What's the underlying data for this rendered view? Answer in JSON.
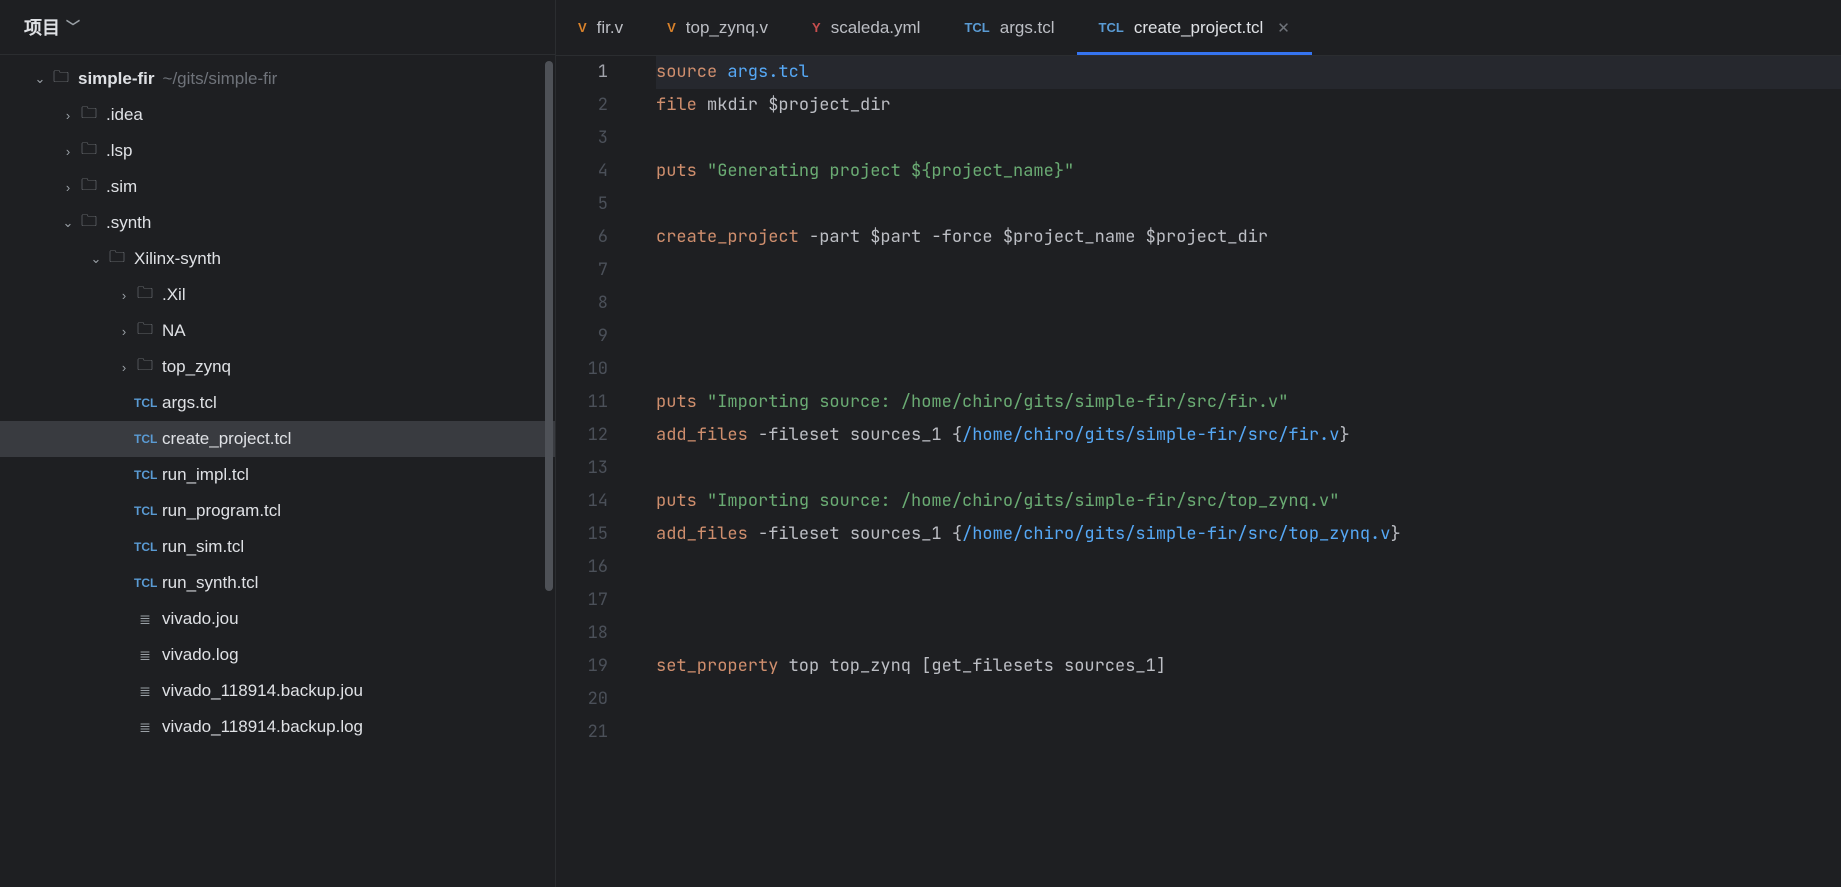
{
  "sidebar": {
    "title": "项目",
    "root": {
      "name": "simple-fir",
      "path": "~/gits/simple-fir"
    },
    "items": [
      {
        "type": "folder",
        "name": ".idea",
        "depth": 1,
        "expanded": false
      },
      {
        "type": "folder",
        "name": ".lsp",
        "depth": 1,
        "expanded": false
      },
      {
        "type": "folder",
        "name": ".sim",
        "depth": 1,
        "expanded": false
      },
      {
        "type": "folder",
        "name": ".synth",
        "depth": 1,
        "expanded": true
      },
      {
        "type": "folder",
        "name": "Xilinx-synth",
        "depth": 2,
        "expanded": true
      },
      {
        "type": "folder",
        "name": ".Xil",
        "depth": 3,
        "expanded": false
      },
      {
        "type": "folder",
        "name": "NA",
        "depth": 3,
        "expanded": false
      },
      {
        "type": "folder",
        "name": "top_zynq",
        "depth": 3,
        "expanded": false
      },
      {
        "type": "file",
        "icon": "tcl",
        "name": "args.tcl",
        "depth": 3
      },
      {
        "type": "file",
        "icon": "tcl",
        "name": "create_project.tcl",
        "depth": 3,
        "selected": true
      },
      {
        "type": "file",
        "icon": "tcl",
        "name": "run_impl.tcl",
        "depth": 3
      },
      {
        "type": "file",
        "icon": "tcl",
        "name": "run_program.tcl",
        "depth": 3
      },
      {
        "type": "file",
        "icon": "tcl",
        "name": "run_sim.tcl",
        "depth": 3
      },
      {
        "type": "file",
        "icon": "tcl",
        "name": "run_synth.tcl",
        "depth": 3
      },
      {
        "type": "file",
        "icon": "txt",
        "name": "vivado.jou",
        "depth": 3
      },
      {
        "type": "file",
        "icon": "txt",
        "name": "vivado.log",
        "depth": 3
      },
      {
        "type": "file",
        "icon": "txt",
        "name": "vivado_118914.backup.jou",
        "depth": 3
      },
      {
        "type": "file",
        "icon": "txt",
        "name": "vivado_118914.backup.log",
        "depth": 3
      }
    ]
  },
  "tabs": [
    {
      "icon": "v",
      "iconText": "V",
      "label": "fir.v"
    },
    {
      "icon": "v",
      "iconText": "V",
      "label": "top_zynq.v"
    },
    {
      "icon": "y",
      "iconText": "Y",
      "label": "scaleda.yml"
    },
    {
      "icon": "tcl",
      "iconText": "TCL",
      "label": "args.tcl"
    },
    {
      "icon": "tcl",
      "iconText": "TCL",
      "label": "create_project.tcl",
      "active": true,
      "closeable": true
    }
  ],
  "editor": {
    "currentLine": 1,
    "lines": [
      [
        {
          "c": "tok-kw",
          "t": "source"
        },
        {
          "c": "",
          "t": " "
        },
        {
          "c": "tok-path",
          "t": "args.tcl"
        }
      ],
      [
        {
          "c": "tok-kw",
          "t": "file"
        },
        {
          "c": "",
          "t": " mkdir "
        },
        {
          "c": "tok-var",
          "t": "$project_dir"
        }
      ],
      [],
      [
        {
          "c": "tok-kw",
          "t": "puts"
        },
        {
          "c": "",
          "t": " "
        },
        {
          "c": "tok-str",
          "t": "\"Generating project ${project_name}\""
        }
      ],
      [],
      [
        {
          "c": "tok-kw",
          "t": "create_project"
        },
        {
          "c": "",
          "t": " "
        },
        {
          "c": "tok-opt",
          "t": "-part"
        },
        {
          "c": "",
          "t": " "
        },
        {
          "c": "tok-var",
          "t": "$part"
        },
        {
          "c": "",
          "t": " "
        },
        {
          "c": "tok-opt",
          "t": "-force"
        },
        {
          "c": "",
          "t": " "
        },
        {
          "c": "tok-var",
          "t": "$project_name"
        },
        {
          "c": "",
          "t": " "
        },
        {
          "c": "tok-var",
          "t": "$project_dir"
        }
      ],
      [],
      [],
      [],
      [],
      [
        {
          "c": "tok-kw",
          "t": "puts"
        },
        {
          "c": "",
          "t": " "
        },
        {
          "c": "tok-str",
          "t": "\"Importing source: /home/chiro/gits/simple-fir/src/fir.v\""
        }
      ],
      [
        {
          "c": "tok-kw",
          "t": "add_files"
        },
        {
          "c": "",
          "t": " "
        },
        {
          "c": "tok-opt",
          "t": "-fileset"
        },
        {
          "c": "",
          "t": " sources_1 {"
        },
        {
          "c": "tok-path",
          "t": "/home/chiro/gits/simple-fir/src/fir.v"
        },
        {
          "c": "",
          "t": "}"
        }
      ],
      [],
      [
        {
          "c": "tok-kw",
          "t": "puts"
        },
        {
          "c": "",
          "t": " "
        },
        {
          "c": "tok-str",
          "t": "\"Importing source: /home/chiro/gits/simple-fir/src/top_zynq.v\""
        }
      ],
      [
        {
          "c": "tok-kw",
          "t": "add_files"
        },
        {
          "c": "",
          "t": " "
        },
        {
          "c": "tok-opt",
          "t": "-fileset"
        },
        {
          "c": "",
          "t": " sources_1 {"
        },
        {
          "c": "tok-path",
          "t": "/home/chiro/gits/simple-fir/src/top_zynq.v"
        },
        {
          "c": "",
          "t": "}"
        }
      ],
      [],
      [],
      [],
      [
        {
          "c": "tok-kw",
          "t": "set_property"
        },
        {
          "c": "",
          "t": " top top_zynq ["
        },
        {
          "c": "tok-call",
          "t": "get_filesets"
        },
        {
          "c": "",
          "t": " sources_1]"
        }
      ],
      [],
      []
    ]
  }
}
